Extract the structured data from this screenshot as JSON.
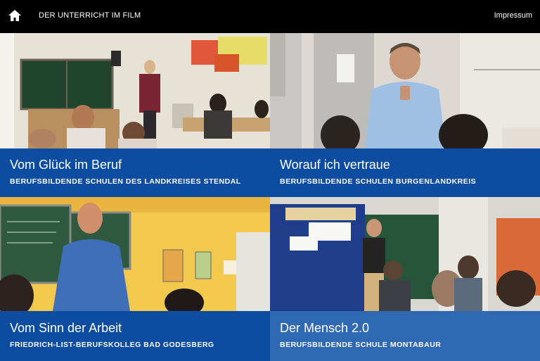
{
  "header": {
    "site_title": "DER UNTERRICHT IM FILM",
    "impressum_label": "Impressum",
    "home_icon": "home-icon"
  },
  "tiles": [
    {
      "title": "Vom Glück im Beruf",
      "school": "BERUFSBILDENDE SCHULEN DES LANDKREISES STENDAL"
    },
    {
      "title": "Worauf ich vertraue",
      "school": "BERUFSBILDENDE SCHULEN BURGENLANDKREIS"
    },
    {
      "title": "Vom Sinn der Arbeit",
      "school": "FRIEDRICH-LIST-BERUFSKOLLEG BAD GODESBERG"
    },
    {
      "title": "Der Mensch 2.0",
      "school": "BERUFSBILDENDE SCHULE MONTABAUR"
    }
  ],
  "colors": {
    "caption_blue": "#0c4da2",
    "caption_blue_light": "#3069b3",
    "header_bg": "#000000"
  }
}
